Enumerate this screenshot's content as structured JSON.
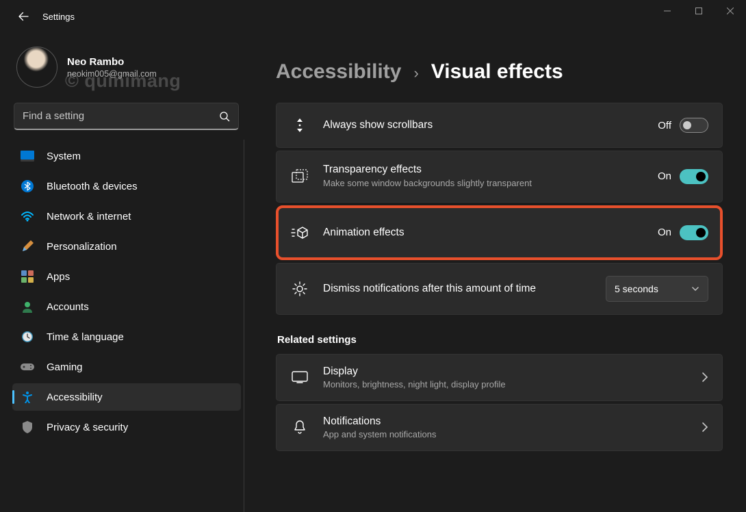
{
  "window": {
    "title": "Settings"
  },
  "profile": {
    "name": "Neo Rambo",
    "email": "neokim005@gmail.com"
  },
  "watermark": "© quinimang",
  "search": {
    "placeholder": "Find a setting"
  },
  "sidebar": {
    "items": [
      {
        "label": "System"
      },
      {
        "label": "Bluetooth & devices"
      },
      {
        "label": "Network & internet"
      },
      {
        "label": "Personalization"
      },
      {
        "label": "Apps"
      },
      {
        "label": "Accounts"
      },
      {
        "label": "Time & language"
      },
      {
        "label": "Gaming"
      },
      {
        "label": "Accessibility"
      },
      {
        "label": "Privacy & security"
      }
    ]
  },
  "breadcrumb": {
    "parent": "Accessibility",
    "sep": "›",
    "current": "Visual effects"
  },
  "settings": {
    "scrollbars": {
      "title": "Always show scrollbars",
      "state_label": "Off"
    },
    "transparency": {
      "title": "Transparency effects",
      "desc": "Make some window backgrounds slightly transparent",
      "state_label": "On"
    },
    "animation": {
      "title": "Animation effects",
      "state_label": "On"
    },
    "dismiss": {
      "title": "Dismiss notifications after this amount of time",
      "value": "5 seconds"
    }
  },
  "related": {
    "header": "Related settings",
    "display": {
      "title": "Display",
      "desc": "Monitors, brightness, night light, display profile"
    },
    "notifications": {
      "title": "Notifications",
      "desc": "App and system notifications"
    }
  }
}
